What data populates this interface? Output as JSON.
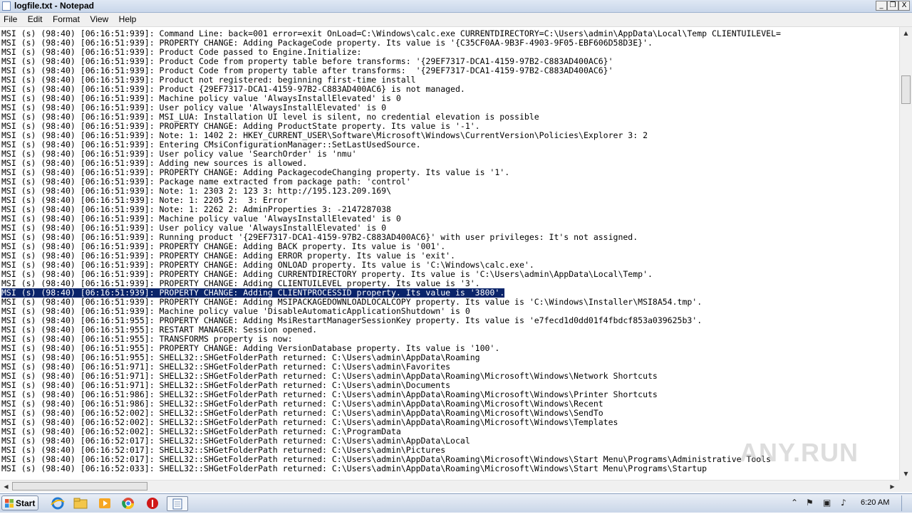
{
  "window": {
    "title": "logfile.txt - Notepad",
    "controls": {
      "minimize": "_",
      "restore": "❐",
      "close": "X"
    }
  },
  "menu": [
    "File",
    "Edit",
    "Format",
    "View",
    "Help"
  ],
  "editor": {
    "selected_line_index": 28,
    "lines": [
      "MSI (s) (98:40) [06:16:51:939]: Command Line: back=001 error=exit OnLoad=C:\\Windows\\calc.exe CURRENTDIRECTORY=C:\\Users\\admin\\AppData\\Local\\Temp CLIENTUILEVEL=",
      "MSI (s) (98:40) [06:16:51:939]: PROPERTY CHANGE: Adding PackageCode property. Its value is '{C35CF0AA-9B3F-4903-9F05-EBF606D58D3E}'.",
      "MSI (s) (98:40) [06:16:51:939]: Product Code passed to Engine.Initialize:",
      "MSI (s) (98:40) [06:16:51:939]: Product Code from property table before transforms: '{29EF7317-DCA1-4159-97B2-C883AD400AC6}'",
      "MSI (s) (98:40) [06:16:51:939]: Product Code from property table after transforms:  '{29EF7317-DCA1-4159-97B2-C883AD400AC6}'",
      "MSI (s) (98:40) [06:16:51:939]: Product not registered: beginning first-time install",
      "MSI (s) (98:40) [06:16:51:939]: Product {29EF7317-DCA1-4159-97B2-C883AD400AC6} is not managed.",
      "MSI (s) (98:40) [06:16:51:939]: Machine policy value 'AlwaysInstallElevated' is 0",
      "MSI (s) (98:40) [06:16:51:939]: User policy value 'AlwaysInstallElevated' is 0",
      "MSI (s) (98:40) [06:16:51:939]: MSI_LUA: Installation UI level is silent, no credential elevation is possible",
      "MSI (s) (98:40) [06:16:51:939]: PROPERTY CHANGE: Adding ProductState property. Its value is '-1'.",
      "MSI (s) (98:40) [06:16:51:939]: Note: 1: 1402 2: HKEY_CURRENT_USER\\Software\\Microsoft\\Windows\\CurrentVersion\\Policies\\Explorer 3: 2",
      "MSI (s) (98:40) [06:16:51:939]: Entering CMsiConfigurationManager::SetLastUsedSource.",
      "MSI (s) (98:40) [06:16:51:939]: User policy value 'SearchOrder' is 'nmu'",
      "MSI (s) (98:40) [06:16:51:939]: Adding new sources is allowed.",
      "MSI (s) (98:40) [06:16:51:939]: PROPERTY CHANGE: Adding PackagecodeChanging property. Its value is '1'.",
      "MSI (s) (98:40) [06:16:51:939]: Package name extracted from package path: 'control'",
      "MSI (s) (98:40) [06:16:51:939]: Note: 1: 2303 2: 123 3: http://195.123.209.169\\",
      "MSI (s) (98:40) [06:16:51:939]: Note: 1: 2205 2:  3: Error",
      "MSI (s) (98:40) [06:16:51:939]: Note: 1: 2262 2: AdminProperties 3: -2147287038",
      "MSI (s) (98:40) [06:16:51:939]: Machine policy value 'AlwaysInstallElevated' is 0",
      "MSI (s) (98:40) [06:16:51:939]: User policy value 'AlwaysInstallElevated' is 0",
      "MSI (s) (98:40) [06:16:51:939]: Running product '{29EF7317-DCA1-4159-97B2-C883AD400AC6}' with user privileges: It's not assigned.",
      "MSI (s) (98:40) [06:16:51:939]: PROPERTY CHANGE: Adding BACK property. Its value is '001'.",
      "MSI (s) (98:40) [06:16:51:939]: PROPERTY CHANGE: Adding ERROR property. Its value is 'exit'.",
      "MSI (s) (98:40) [06:16:51:939]: PROPERTY CHANGE: Adding ONLOAD property. Its value is 'C:\\Windows\\calc.exe'.",
      "MSI (s) (98:40) [06:16:51:939]: PROPERTY CHANGE: Adding CURRENTDIRECTORY property. Its value is 'C:\\Users\\admin\\AppData\\Local\\Temp'.",
      "MSI (s) (98:40) [06:16:51:939]: PROPERTY CHANGE: Adding CLIENTUILEVEL property. Its value is '3'.",
      "MSI (s) (98:40) [06:16:51:939]: PROPERTY CHANGE: Adding CLIENTPROCESSID property. Its value is '3800'.",
      "MSI (s) (98:40) [06:16:51:939]: PROPERTY CHANGE: Adding MSIPACKAGEDOWNLOADLOCALCOPY property. Its value is 'C:\\Windows\\Installer\\MSI8A54.tmp'.",
      "MSI (s) (98:40) [06:16:51:939]: Machine policy value 'DisableAutomaticApplicationShutdown' is 0",
      "MSI (s) (98:40) [06:16:51:955]: PROPERTY CHANGE: Adding MsiRestartManagerSessionKey property. Its value is 'e7fecd1d0dd01f4fbdcf853a039625b3'.",
      "MSI (s) (98:40) [06:16:51:955]: RESTART MANAGER: Session opened.",
      "MSI (s) (98:40) [06:16:51:955]: TRANSFORMS property is now:",
      "MSI (s) (98:40) [06:16:51:955]: PROPERTY CHANGE: Adding VersionDatabase property. Its value is '100'.",
      "MSI (s) (98:40) [06:16:51:955]: SHELL32::SHGetFolderPath returned: C:\\Users\\admin\\AppData\\Roaming",
      "MSI (s) (98:40) [06:16:51:971]: SHELL32::SHGetFolderPath returned: C:\\Users\\admin\\Favorites",
      "MSI (s) (98:40) [06:16:51:971]: SHELL32::SHGetFolderPath returned: C:\\Users\\admin\\AppData\\Roaming\\Microsoft\\Windows\\Network Shortcuts",
      "MSI (s) (98:40) [06:16:51:971]: SHELL32::SHGetFolderPath returned: C:\\Users\\admin\\Documents",
      "MSI (s) (98:40) [06:16:51:986]: SHELL32::SHGetFolderPath returned: C:\\Users\\admin\\AppData\\Roaming\\Microsoft\\Windows\\Printer Shortcuts",
      "MSI (s) (98:40) [06:16:51:986]: SHELL32::SHGetFolderPath returned: C:\\Users\\admin\\AppData\\Roaming\\Microsoft\\Windows\\Recent",
      "MSI (s) (98:40) [06:16:52:002]: SHELL32::SHGetFolderPath returned: C:\\Users\\admin\\AppData\\Roaming\\Microsoft\\Windows\\SendTo",
      "MSI (s) (98:40) [06:16:52:002]: SHELL32::SHGetFolderPath returned: C:\\Users\\admin\\AppData\\Roaming\\Microsoft\\Windows\\Templates",
      "MSI (s) (98:40) [06:16:52:002]: SHELL32::SHGetFolderPath returned: C:\\ProgramData",
      "MSI (s) (98:40) [06:16:52:017]: SHELL32::SHGetFolderPath returned: C:\\Users\\admin\\AppData\\Local",
      "MSI (s) (98:40) [06:16:52:017]: SHELL32::SHGetFolderPath returned: C:\\Users\\admin\\Pictures",
      "MSI (s) (98:40) [06:16:52:017]: SHELL32::SHGetFolderPath returned: C:\\Users\\admin\\AppData\\Roaming\\Microsoft\\Windows\\Start Menu\\Programs\\Administrative Tools",
      "MSI (s) (98:40) [06:16:52:033]: SHELL32::SHGetFolderPath returned: C:\\Users\\admin\\AppData\\Roaming\\Microsoft\\Windows\\Start Menu\\Programs\\Startup"
    ]
  },
  "scrollbars": {
    "up": "▲",
    "down": "▼",
    "left": "◀",
    "right": "▶"
  },
  "watermark": "ANY.RUN",
  "taskbar": {
    "start_label": "Start",
    "clock": "6:20 AM",
    "tray_icons": [
      "chevron-up-icon",
      "flag-icon",
      "network-icon",
      "volume-icon"
    ],
    "tray_glyphs": [
      "⌃",
      "⚑",
      "▣",
      "♪"
    ]
  },
  "colors": {
    "selection": "#0a246a",
    "titlebar": "#c9d7ea",
    "taskbar": "#c9d6e8"
  }
}
